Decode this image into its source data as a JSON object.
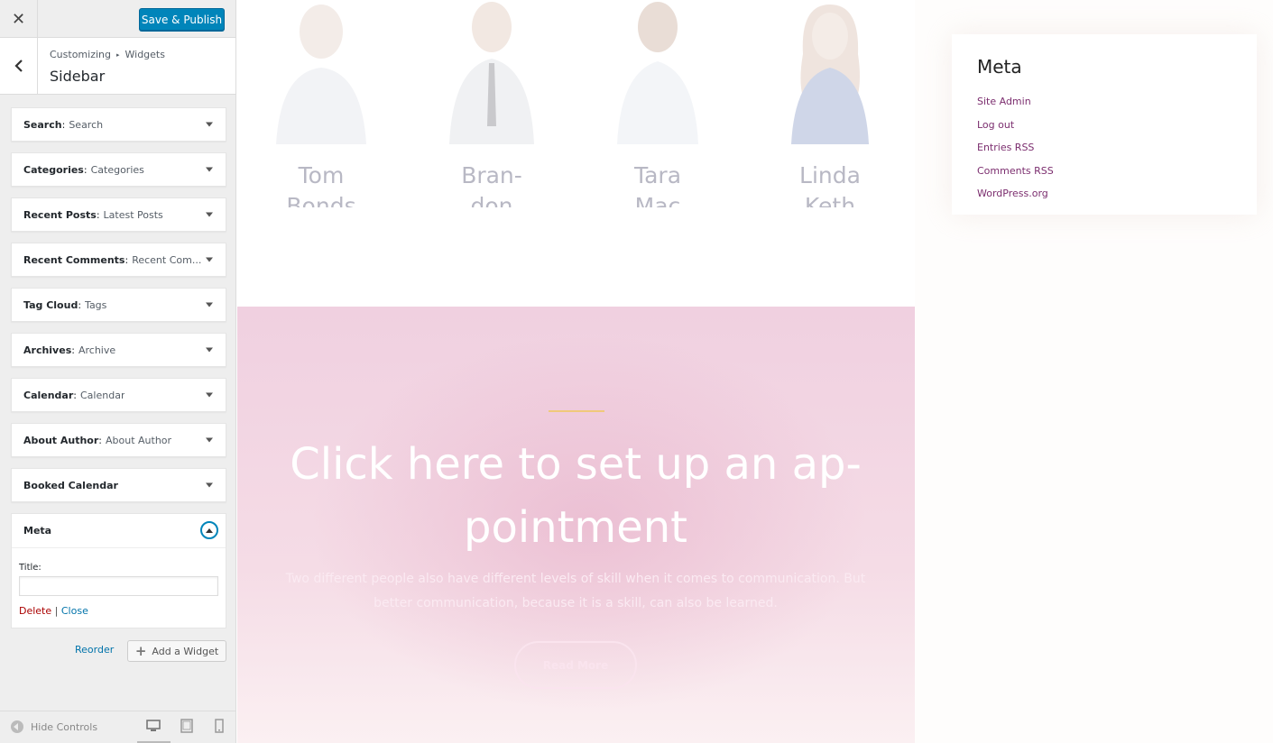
{
  "customizer": {
    "save_label": "Save & Publish",
    "close_glyph": "✕",
    "breadcrumb": {
      "root": "Customizing",
      "section": "Widgets"
    },
    "section_title": "Sidebar",
    "widgets": [
      {
        "name": "Search",
        "title": "Search"
      },
      {
        "name": "Categories",
        "title": "Categories"
      },
      {
        "name": "Recent Posts",
        "title": "Latest Posts"
      },
      {
        "name": "Recent Comments",
        "title": "Recent Com..."
      },
      {
        "name": "Tag Cloud",
        "title": "Tags"
      },
      {
        "name": "Archives",
        "title": "Archive"
      },
      {
        "name": "Calendar",
        "title": "Calendar"
      },
      {
        "name": "About Author",
        "title": "About Author"
      },
      {
        "name": "Booked Calendar",
        "title": ""
      }
    ],
    "meta_widget": {
      "name": "Meta",
      "title_label": "Title:",
      "title_value": "",
      "delete_label": "Delete",
      "separator": "|",
      "close_label": "Close"
    },
    "reorder_label": "Reorder",
    "add_widget_label": "Add a Widget",
    "hide_controls_label": "Hide Controls",
    "accent_color": "#0085ba"
  },
  "preview": {
    "team": [
      {
        "name": "Tom Bonds",
        "display": "Tom\nBonds"
      },
      {
        "name": "Brandon",
        "display": "Bran-\ndon"
      },
      {
        "name": "Tara Mac",
        "display": "Tara\nMac"
      },
      {
        "name": "Linda Keth",
        "display": "Linda\nKeth"
      }
    ],
    "hero": {
      "title": "Click here to set up an ap- pointment",
      "text": "Two different people also have different levels of skill when it comes to communication. But better communication, because it is a skill, can also be learned.",
      "button": "Read More"
    },
    "sidebar_meta": {
      "title": "Meta",
      "links": [
        "Site Admin",
        "Log out",
        "Entries RSS",
        "Comments RSS",
        "WordPress.org"
      ]
    }
  }
}
